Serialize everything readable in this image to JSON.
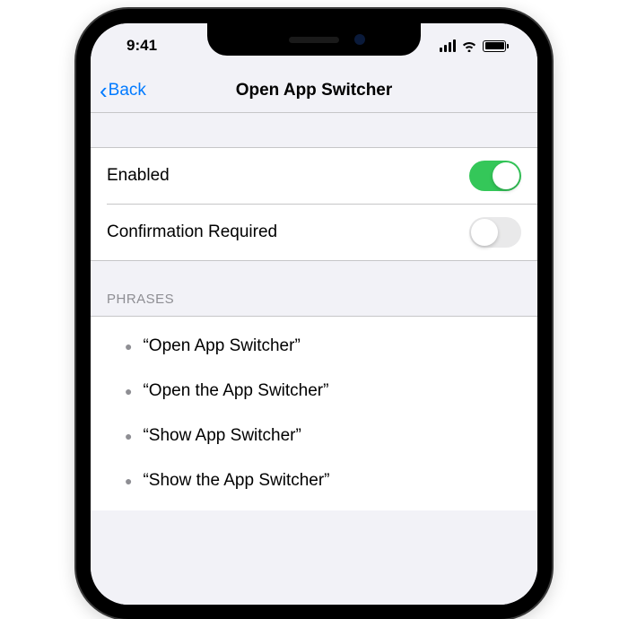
{
  "status": {
    "time": "9:41"
  },
  "nav": {
    "back_label": "Back",
    "title": "Open App Switcher"
  },
  "settings": {
    "enabled": {
      "label": "Enabled",
      "on": true
    },
    "confirmation": {
      "label": "Confirmation Required",
      "on": false
    }
  },
  "phrases": {
    "header": "PHRASES",
    "items": [
      "“Open App Switcher”",
      "“Open the App Switcher”",
      "“Show App Switcher”",
      "“Show the App Switcher”"
    ]
  }
}
